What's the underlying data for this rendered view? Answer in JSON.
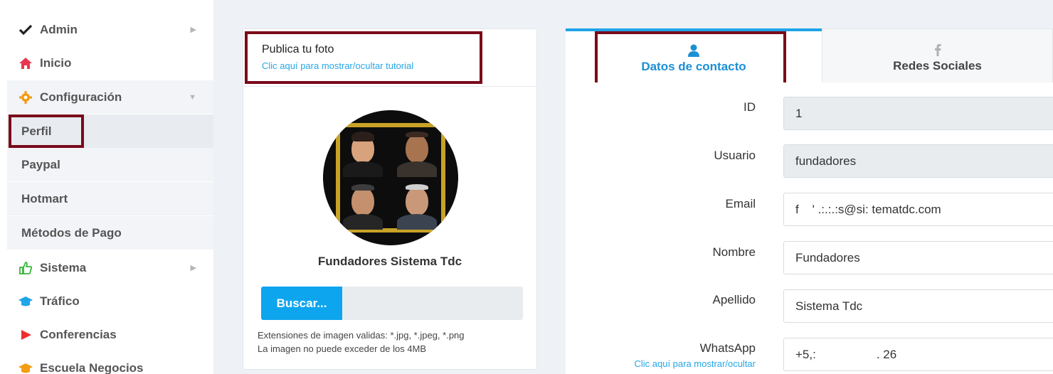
{
  "sidebar": {
    "items": [
      {
        "label": "Admin",
        "icon": "check-icon"
      },
      {
        "label": "Inicio",
        "icon": "home-icon"
      },
      {
        "label": "Configuración",
        "icon": "gear-icon"
      },
      {
        "label": "Sistema",
        "icon": "thumbs-up-icon"
      },
      {
        "label": "Tráfico",
        "icon": "graduation-cap-icon"
      },
      {
        "label": "Conferencias",
        "icon": "play-icon"
      },
      {
        "label": "Escuela Negocios",
        "icon": "graduation-cap-icon"
      }
    ],
    "sub_items": [
      "Perfil",
      "Paypal",
      "Hotmart",
      "Métodos de Pago"
    ]
  },
  "photo_card": {
    "title": "Publica tu foto",
    "tutorial_link": "Clic aquí para mostrar/ocultar tutorial",
    "name": "Fundadores Sistema Tdc",
    "browse_label": "Buscar...",
    "hint_extensions": "Extensiones de imagen validas: *.jpg, *.jpeg, *.png",
    "hint_size": "La imagen no puede exceder de los 4MB"
  },
  "tabs": [
    {
      "label": "Datos de contacto",
      "icon": "user-icon",
      "active": true
    },
    {
      "label": "Redes Sociales",
      "icon": "facebook-icon",
      "active": false
    }
  ],
  "form": {
    "id_label": "ID",
    "id_value": "1",
    "user_label": "Usuario",
    "user_value": "fundadores",
    "email_label": "Email",
    "email_value": "f    ' .:.:.:s@si: tematdc.com",
    "name_label": "Nombre",
    "name_value": "Fundadores",
    "lastname_label": "Apellido",
    "lastname_value": "Sistema Tdc",
    "whatsapp_label": "WhatsApp",
    "whatsapp_value": "+5,:                  . 26",
    "whatsapp_link": "Clic aquí para mostrar/ocultar"
  },
  "colors": {
    "accent": "#1ea4e9",
    "highlight": "#7a0a1a",
    "button": "#0ea5ef",
    "link": "#27a6e6"
  }
}
